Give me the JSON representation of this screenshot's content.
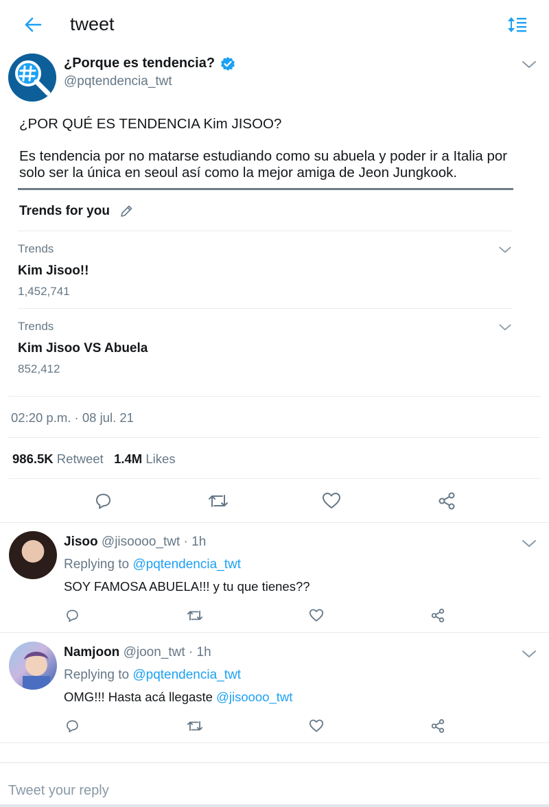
{
  "header": {
    "back_icon": "arrow-left-icon",
    "title": "tweet",
    "sort_icon": "sort-lines-icon"
  },
  "tweet": {
    "avatar_icon": "hashtag-magnifier-logo",
    "author_name": "¿Porque es tendencia?",
    "verified_icon": "verified-badge-icon",
    "author_handle": "@pqtendencia_twt",
    "text_line1": "¿POR QUÉ ES TENDENCIA Kim JISOO?",
    "text_line2": "Es tendencia por no matarse estudiando como su abuela y poder ir a Italia por",
    "text_line3": "solo ser la única en seoul así como la mejor amiga de Jeon Jungkook.",
    "card": {
      "title": "Trends for you",
      "edit_icon": "pencil-icon",
      "trends": [
        {
          "category": "Trends",
          "name": "Kim Jisoo!!",
          "count": "1,452,741"
        },
        {
          "category": "Trends",
          "name": "Kim Jisoo VS Abuela",
          "count": "852,412"
        }
      ]
    },
    "timestamp": "02:20 p.m. · 08 jul. 21",
    "retweets_count": "986.5K",
    "retweets_label": "Retweet",
    "likes_count": "1.4M",
    "likes_label": "Likes"
  },
  "replies": [
    {
      "name": "Jisoo",
      "meta": "@jisoooo_twt · 1h",
      "replying_prefix": "Replying to",
      "replying_to": "@pqtendencia_twt",
      "text": "SOY FAMOSA ABUELA!!! y tu que tienes??",
      "mention": ""
    },
    {
      "name": "Namjoon",
      "meta": "@joon_twt · 1h",
      "replying_prefix": "Replying to",
      "replying_to": "@pqtendencia_twt",
      "text": "OMG!!! Hasta acá llegaste",
      "mention": "@jisoooo_twt"
    }
  ],
  "reply_box": {
    "placeholder": "Tweet your reply"
  },
  "colors": {
    "accent": "#1da1f2",
    "secondary_text": "#657786",
    "divider": "#e6ecf0",
    "logo_bg": "#0d5f9a"
  }
}
